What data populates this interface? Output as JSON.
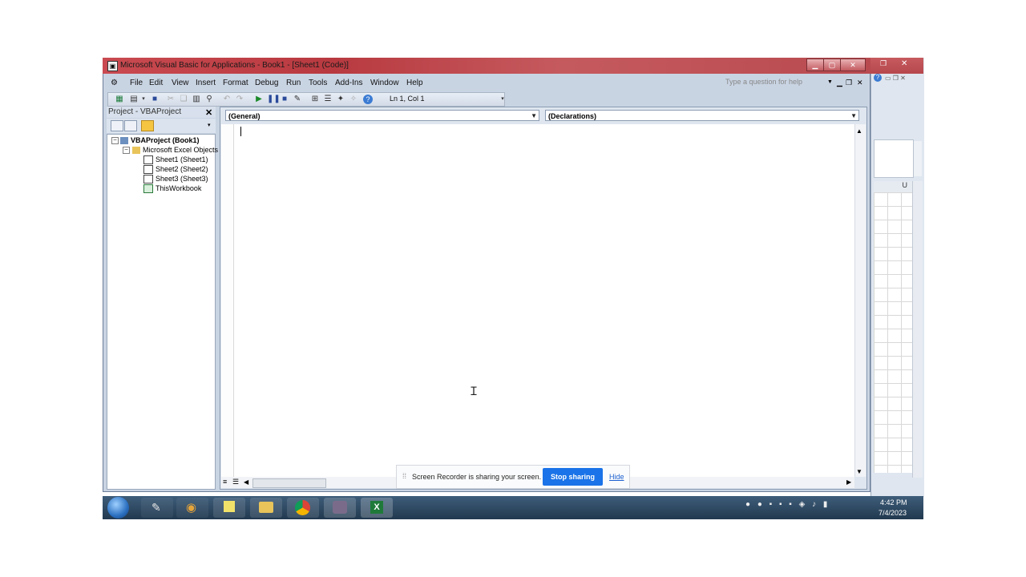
{
  "window": {
    "title": "Microsoft Visual Basic for Applications - Book1 - [Sheet1 (Code)]"
  },
  "menu": {
    "items": [
      {
        "label": "File"
      },
      {
        "label": "Edit"
      },
      {
        "label": "View"
      },
      {
        "label": "Insert"
      },
      {
        "label": "Format"
      },
      {
        "label": "Debug"
      },
      {
        "label": "Run"
      },
      {
        "label": "Tools"
      },
      {
        "label": "Add-Ins"
      },
      {
        "label": "Window"
      },
      {
        "label": "Help"
      }
    ],
    "help_placeholder": "Type a question for help"
  },
  "toolbar": {
    "position": "Ln 1, Col 1"
  },
  "project_pane": {
    "title": "Project - VBAProject",
    "tree": {
      "root": "VBAProject (Book1)",
      "folder": "Microsoft Excel Objects",
      "items": [
        "Sheet1 (Sheet1)",
        "Sheet2 (Sheet2)",
        "Sheet3 (Sheet3)",
        "ThisWorkbook"
      ]
    }
  },
  "code_window": {
    "object_combo": "(General)",
    "procedure_combo": "(Declarations)"
  },
  "excel_bg": {
    "column_header": "U"
  },
  "share_bar": {
    "message": "Screen Recorder is sharing your screen.",
    "stop_label": "Stop sharing",
    "hide_label": "Hide"
  },
  "taskbar": {
    "time": "4:42 PM",
    "date": "7/4/2023"
  },
  "colors": {
    "title_red": "#c94a50",
    "stop_blue": "#1a73e8",
    "link_blue": "#1a5fd0",
    "taskbar": "#2c4660"
  }
}
